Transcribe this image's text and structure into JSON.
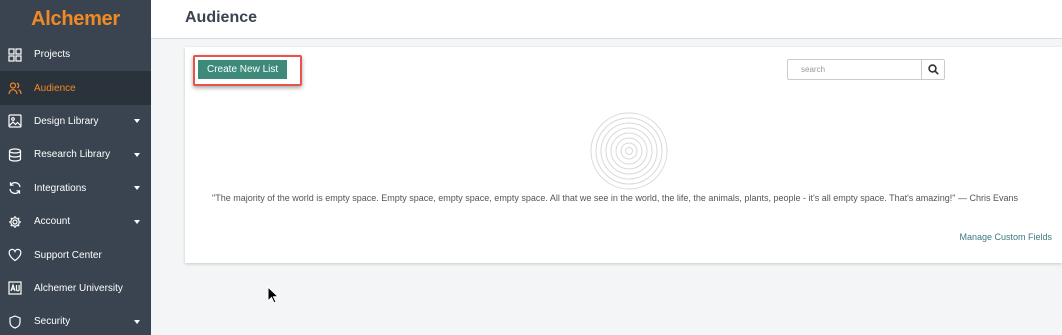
{
  "brand": {
    "logo_text": "Alchemer",
    "accent_color": "#f08a24"
  },
  "sidebar": {
    "items": [
      {
        "label": "Projects",
        "icon": "grid-icon",
        "active": false,
        "has_caret": false
      },
      {
        "label": "Audience",
        "icon": "users-icon",
        "active": true,
        "has_caret": false
      },
      {
        "label": "Design Library",
        "icon": "image-icon",
        "active": false,
        "has_caret": true
      },
      {
        "label": "Research Library",
        "icon": "database-icon",
        "active": false,
        "has_caret": true
      },
      {
        "label": "Integrations",
        "icon": "refresh-icon",
        "active": false,
        "has_caret": true
      },
      {
        "label": "Account",
        "icon": "gear-icon",
        "active": false,
        "has_caret": true
      },
      {
        "label": "Support Center",
        "icon": "heart-icon",
        "active": false,
        "has_caret": false
      },
      {
        "label": "Alchemer University",
        "icon": "university-icon",
        "active": false,
        "has_caret": false
      },
      {
        "label": "Security",
        "icon": "shield-icon",
        "active": false,
        "has_caret": true
      }
    ]
  },
  "header": {
    "title": "Audience"
  },
  "main": {
    "create_button_label": "Create New List",
    "search": {
      "placeholder": "search",
      "value": ""
    },
    "empty_quote": "\"The majority of the world is empty space. Empty space, empty space, empty space. All that we see in the world, the life, the animals, plants, people - it's all empty space. That's amazing!\" — Chris Evans",
    "manage_link": "Manage Custom Fields"
  },
  "colors": {
    "sidebar_bg": "#3a4450",
    "sidebar_active_bg": "#2a323c",
    "button_green": "#3d8a7a",
    "highlight_red": "#e8524a",
    "link_teal": "#3d7a82"
  }
}
